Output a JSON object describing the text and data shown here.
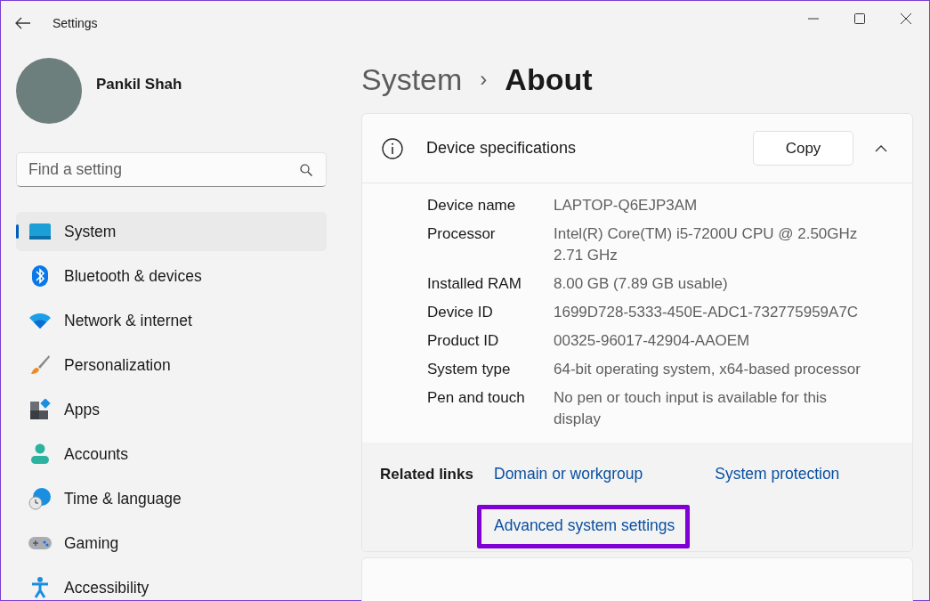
{
  "window": {
    "title": "Settings"
  },
  "user": {
    "name": "Pankil Shah"
  },
  "search": {
    "placeholder": "Find a setting"
  },
  "sidebar": {
    "items": [
      {
        "label": "System",
        "selected": true
      },
      {
        "label": "Bluetooth & devices",
        "selected": false
      },
      {
        "label": "Network & internet",
        "selected": false
      },
      {
        "label": "Personalization",
        "selected": false
      },
      {
        "label": "Apps",
        "selected": false
      },
      {
        "label": "Accounts",
        "selected": false
      },
      {
        "label": "Time & language",
        "selected": false
      },
      {
        "label": "Gaming",
        "selected": false
      },
      {
        "label": "Accessibility",
        "selected": false
      }
    ]
  },
  "breadcrumb": {
    "parent": "System",
    "separator": "›",
    "current": "About"
  },
  "device_specifications": {
    "title": "Device specifications",
    "copy_button": "Copy",
    "expanded": true,
    "rows": [
      {
        "label": "Device name",
        "value": "LAPTOP-Q6EJP3AM"
      },
      {
        "label": "Processor",
        "value": "Intel(R) Core(TM) i5-7200U CPU @ 2.50GHz 2.71 GHz"
      },
      {
        "label": "Installed RAM",
        "value": "8.00 GB (7.89 GB usable)"
      },
      {
        "label": "Device ID",
        "value": "1699D728-5333-450E-ADC1-732775959A7C"
      },
      {
        "label": "Product ID",
        "value": "00325-96017-42904-AAOEM"
      },
      {
        "label": "System type",
        "value": "64-bit operating system, x64-based processor"
      },
      {
        "label": "Pen and touch",
        "value": "No pen or touch input is available for this display"
      }
    ]
  },
  "related_links": {
    "label": "Related links",
    "links": [
      {
        "text": "Domain or workgroup",
        "highlighted": false
      },
      {
        "text": "System protection",
        "highlighted": false
      },
      {
        "text": "Advanced system settings",
        "highlighted": true
      }
    ]
  }
}
